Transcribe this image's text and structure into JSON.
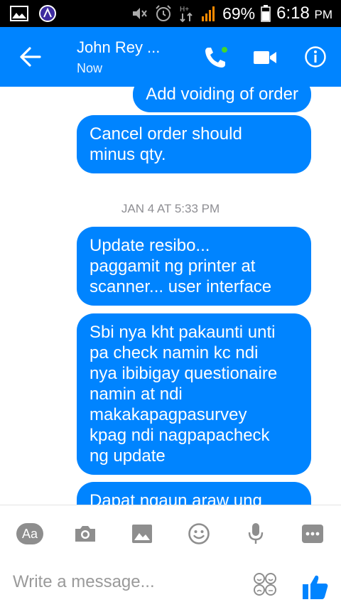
{
  "status_bar": {
    "battery": "69%",
    "time": "6:18",
    "ampm": "PM"
  },
  "header": {
    "contact_name": "John Rey ...",
    "status": "Now"
  },
  "colors": {
    "accent": "#0084ff",
    "status_bar": "#000000",
    "online_dot": "#44d62c",
    "date_text": "#8e8e93",
    "tool_icon": "#8e8e8e"
  },
  "messages": {
    "items": [
      {
        "text": "Add voiding of order",
        "outgoing": true
      },
      {
        "text": "Cancel order should\nminus qty.",
        "outgoing": true
      },
      {
        "text": "Update resibo...\npaggamit ng printer at\nscanner... user interface",
        "outgoing": true
      },
      {
        "text": "Sbi nya kht pakaunti unti\npa check namin kc ndi\nnya ibibigay questionaire\nnamin at ndi\nmakakapagpasurvey\nkpag ndi nagpapacheck\nng update",
        "outgoing": true
      },
      {
        "text": "Dapat ngaun araw ung",
        "outgoing": true
      }
    ],
    "date_separator": "JAN 4 AT 5:33 PM"
  },
  "composer": {
    "aa_label": "Aa",
    "placeholder": "Write a message...",
    "icons": [
      "aa-icon",
      "camera-icon",
      "gallery-icon",
      "sticker-icon",
      "microphone-icon",
      "more-icon",
      "emoji-icon",
      "thumbs-up-icon"
    ]
  }
}
